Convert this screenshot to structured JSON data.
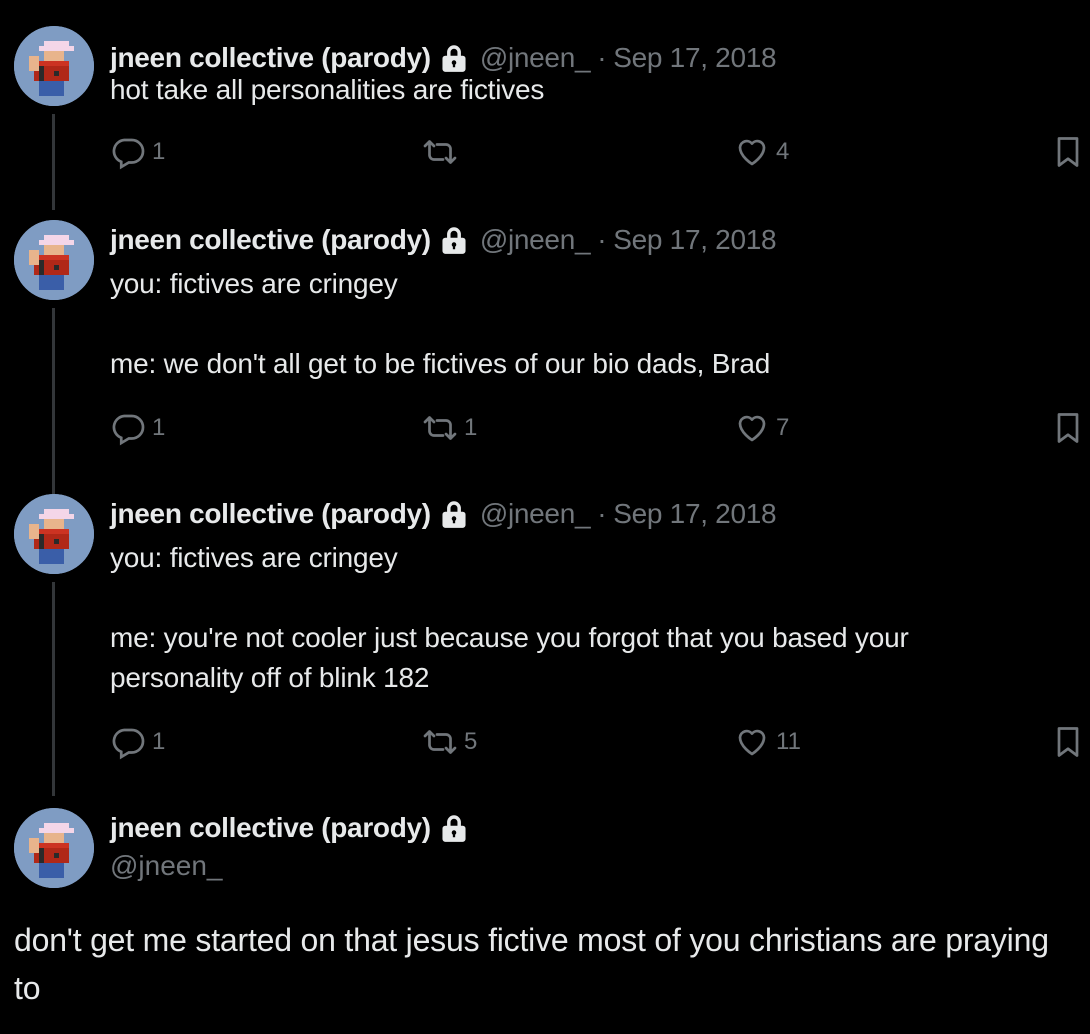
{
  "author": {
    "name": "jneen collective (parody)",
    "handle": "@jneen_",
    "icons": {
      "lock": "lock-icon",
      "avatar": "pixel-art-cowboy-avatar"
    }
  },
  "colors": {
    "background": "#000000",
    "text": "#e7e9ea",
    "muted": "#71767b",
    "thread_line": "#333639"
  },
  "thread": [
    {
      "date": "Sep 17, 2018",
      "text": "hot take all personalities are fictives",
      "replies": "1",
      "retweets": "",
      "likes": "4"
    },
    {
      "date": "Sep 17, 2018",
      "text": "you: fictives are cringey\n\nme: we don't all get to be fictives of our bio dads, Brad",
      "replies": "1",
      "retweets": "1",
      "likes": "7"
    },
    {
      "date": "Sep 17, 2018",
      "text": "you: fictives are cringey\n\nme: you're not cooler just because you forgot that you based your personality off of blink 182",
      "replies": "1",
      "retweets": "5",
      "likes": "11"
    }
  ],
  "main_tweet": {
    "text": "don't get me started on that jesus fictive most of you christians are praying to"
  },
  "separator": "·"
}
